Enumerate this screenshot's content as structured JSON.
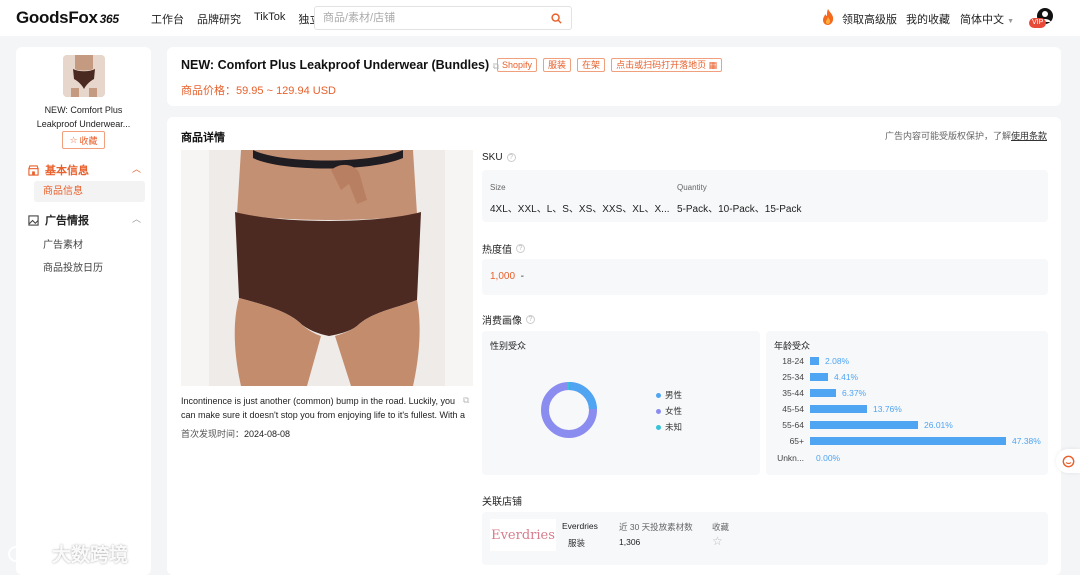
{
  "header": {
    "logo": "GoodsFox",
    "logo_suffix": "365",
    "nav": [
      "工作台",
      "品牌研究",
      "TikTok",
      "独立站"
    ],
    "search_placeholder": "商品/素材/店铺",
    "upgrade": "领取高级版",
    "favorites": "我的收藏",
    "language": "简体中文",
    "vip_badge": "VIP"
  },
  "sidebar": {
    "product_title": "NEW: Comfort Plus Leakproof Underwear...",
    "favorite_button": "收藏",
    "sections": [
      {
        "title": "基本信息",
        "items": [
          "商品信息"
        ]
      },
      {
        "title": "广告情报",
        "items": [
          "广告素材",
          "商品投放日历"
        ]
      }
    ]
  },
  "product": {
    "title": "NEW: Comfort Plus Leakproof Underwear (Bundles)",
    "tags": [
      "Shopify",
      "服装",
      "在架",
      "点击或扫码打开落地页"
    ],
    "price_label": "商品价格：",
    "price": "59.95 ~ 129.94 USD"
  },
  "details": {
    "title": "商品详情",
    "notice": "广告内容可能受版权保护，了解",
    "notice_link": "使用条款",
    "caption": "Incontinence is just another (common) bump in the road. Luckily, you can make sure it doesn't stop you from enjoying life to it's fullest. With a",
    "first_seen_label": "首次发现时间：",
    "first_seen": "2024-08-08",
    "sku": {
      "title": "SKU",
      "size_label": "Size",
      "size_values": "4XL、XXL、L、S、XS、XXS、XL、X...",
      "qty_label": "Quantity",
      "qty_values": "5-Pack、10-Pack、15-Pack"
    },
    "heat": {
      "title": "热度值",
      "value": "1,000",
      "trend": "-"
    },
    "audience": {
      "title": "消费画像",
      "gender_title": "性别受众",
      "gender": [
        {
          "label": "男性",
          "color": "#4fa5f2"
        },
        {
          "label": "女性",
          "color": "#8b8cf0"
        },
        {
          "label": "未知",
          "color": "#36c3d9"
        }
      ],
      "age_title": "年龄受众",
      "ages": [
        {
          "label": "18-24",
          "value": 2.08,
          "pct": "2.08%"
        },
        {
          "label": "25-34",
          "value": 4.41,
          "pct": "4.41%"
        },
        {
          "label": "35-44",
          "value": 6.37,
          "pct": "6.37%"
        },
        {
          "label": "45-54",
          "value": 13.76,
          "pct": "13.76%"
        },
        {
          "label": "55-64",
          "value": 26.01,
          "pct": "26.01%"
        },
        {
          "label": "65+",
          "value": 47.38,
          "pct": "47.38%"
        },
        {
          "label": "Unkn...",
          "value": 0,
          "pct": "0.00%"
        }
      ]
    },
    "store": {
      "title": "关联店铺",
      "logo_text": "Everdries",
      "name": "Everdries",
      "category": "服装",
      "ads_label": "近 30 天投放素材数",
      "ads_value": "1,306",
      "fav_label": "收藏"
    }
  },
  "watermark": "大数跨境"
}
